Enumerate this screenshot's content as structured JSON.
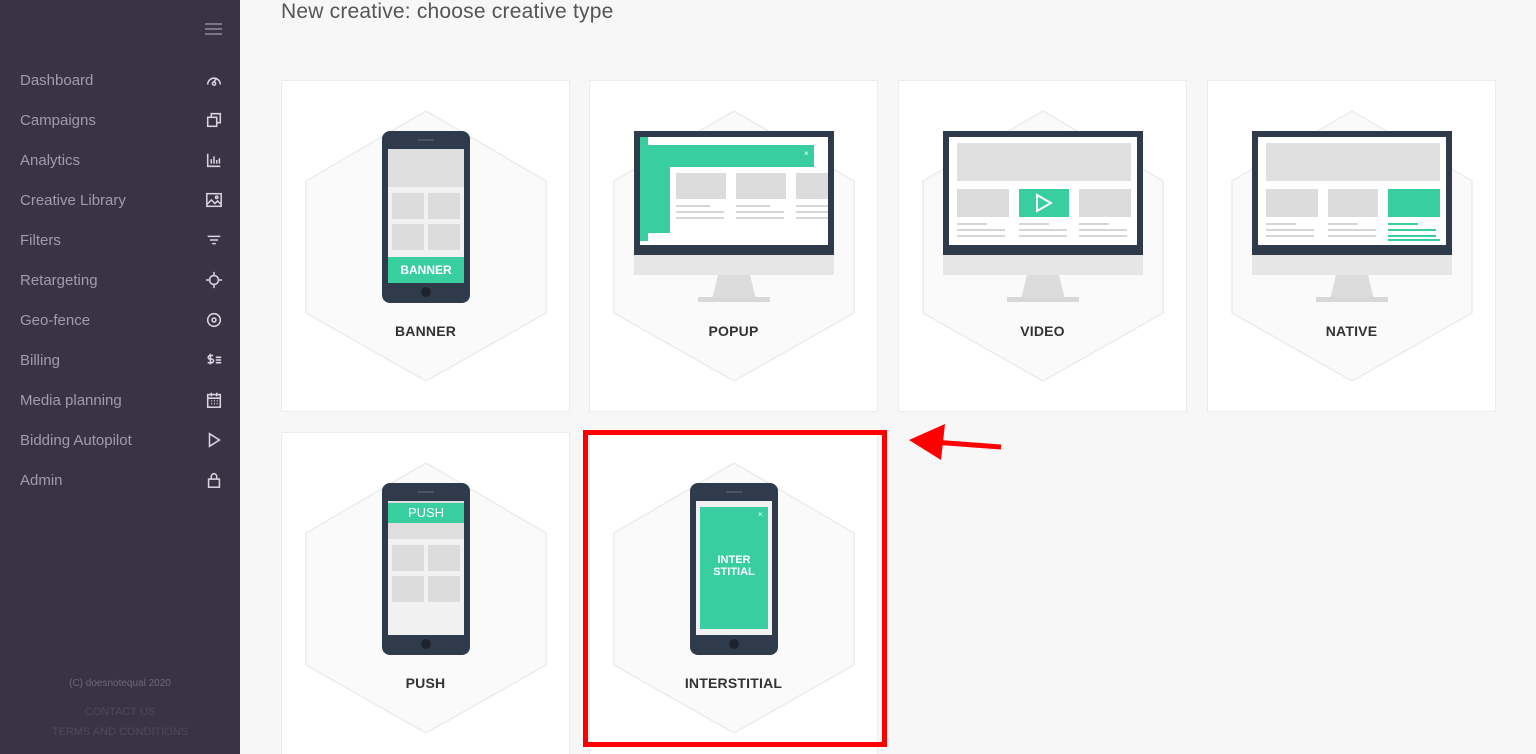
{
  "page": {
    "title": "New creative: choose creative type"
  },
  "sidebar": {
    "items": [
      {
        "label": "Dashboard",
        "icon": "gauge-icon"
      },
      {
        "label": "Campaigns",
        "icon": "copy-icon"
      },
      {
        "label": "Analytics",
        "icon": "bar-chart-icon"
      },
      {
        "label": "Creative Library",
        "icon": "image-icon"
      },
      {
        "label": "Filters",
        "icon": "filter-icon"
      },
      {
        "label": "Retargeting",
        "icon": "crosshair-icon"
      },
      {
        "label": "Geo-fence",
        "icon": "location-pin-icon"
      },
      {
        "label": "Billing",
        "icon": "billing-icon"
      },
      {
        "label": "Media planning",
        "icon": "calendar-icon"
      },
      {
        "label": "Bidding Autopilot",
        "icon": "play-icon"
      },
      {
        "label": "Admin",
        "icon": "lock-icon"
      }
    ],
    "footer": {
      "copyright": "(C) doesnotequal 2020",
      "contact": "CONTACT US",
      "terms": "TERMS AND CONDITIONS"
    }
  },
  "cards": [
    {
      "label": "BANNER",
      "device": "phone",
      "screen_text": "BANNER"
    },
    {
      "label": "POPUP",
      "device": "monitor"
    },
    {
      "label": "VIDEO",
      "device": "monitor"
    },
    {
      "label": "NATIVE",
      "device": "monitor"
    },
    {
      "label": "PUSH",
      "device": "phone",
      "screen_text": "PUSH"
    },
    {
      "label": "INTERSTITIAL",
      "device": "phone",
      "screen_text": "INTER\nSTITIAL"
    }
  ],
  "colors": {
    "sidebar_bg": "#3a3345",
    "accent_green": "#39cea0",
    "device_dark": "#2f3a4b",
    "highlight_red": "#ff0000"
  }
}
